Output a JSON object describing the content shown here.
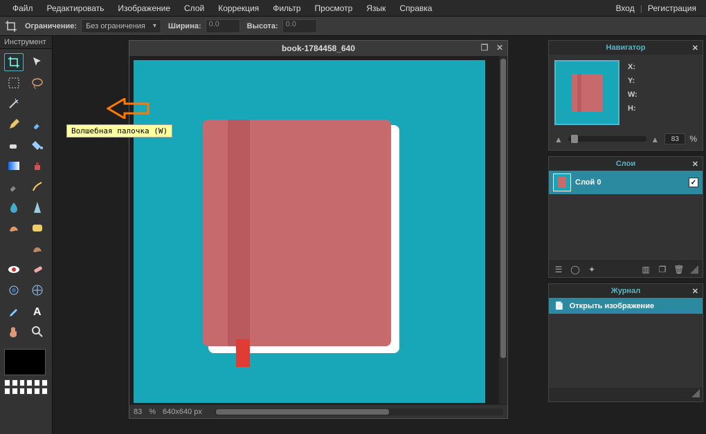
{
  "menu": {
    "file": "Файл",
    "edit": "Редактировать",
    "image": "Изображение",
    "layer": "Слой",
    "adjust": "Коррекция",
    "filter": "Фильтр",
    "view": "Просмотр",
    "lang": "Язык",
    "help": "Справка"
  },
  "auth": {
    "login": "Вход",
    "register": "Регистрация"
  },
  "options": {
    "constraint_label": "Ограничение:",
    "constraint_value": "Без ограничения",
    "width_label": "Ширина:",
    "width_value": "0.0",
    "height_label": "Высота:",
    "height_value": "0.0"
  },
  "tools": {
    "panel_title": "Инструмент",
    "tooltip": "Волшебная палочка (W)"
  },
  "document": {
    "title": "book-1784458_640",
    "zoom": "83",
    "zoom_suffix": "%",
    "dimensions": "640x640 px"
  },
  "navigator": {
    "title": "Навигатор",
    "x": "X:",
    "y": "Y:",
    "w": "W:",
    "h": "H:",
    "zoom": "83",
    "zoom_suffix": "%"
  },
  "layers": {
    "title": "Слои",
    "layer0": "Слой 0"
  },
  "history": {
    "title": "Журнал",
    "open_image": "Открыть изображение"
  }
}
